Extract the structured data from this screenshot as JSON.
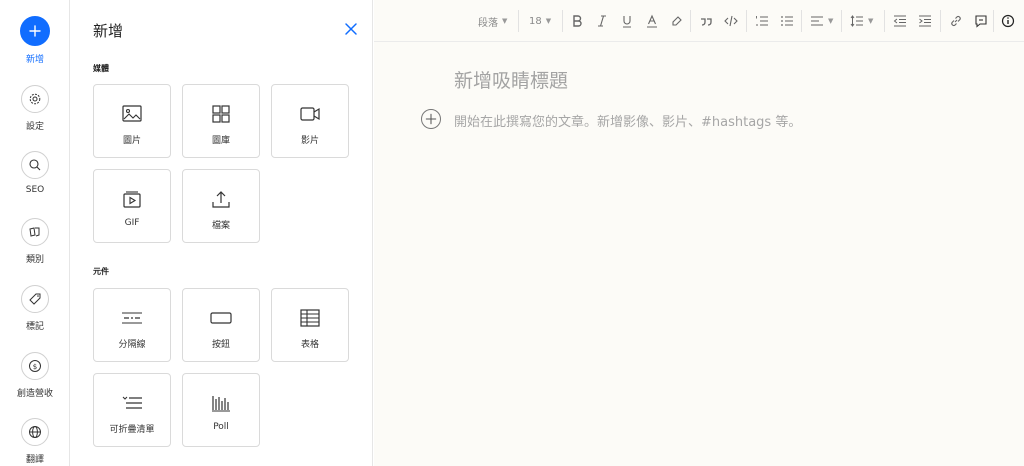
{
  "rail": {
    "items": [
      {
        "label": "新增",
        "icon": "plus-icon"
      },
      {
        "label": "設定",
        "icon": "gear-icon"
      },
      {
        "label": "SEO",
        "icon": "search-icon"
      },
      {
        "label": "類別",
        "icon": "category-icon"
      },
      {
        "label": "標記",
        "icon": "tag-icon"
      },
      {
        "label": "創造營收",
        "icon": "dollar-icon"
      },
      {
        "label": "翻譯",
        "icon": "globe-icon"
      }
    ],
    "accent": "#116dff"
  },
  "panel": {
    "title": "新增",
    "media_label": "媒體",
    "elements_label": "元件",
    "media": [
      {
        "label": "圖片",
        "icon": "image-icon"
      },
      {
        "label": "圖庫",
        "icon": "gallery-icon"
      },
      {
        "label": "影片",
        "icon": "video-icon"
      },
      {
        "label": "GIF",
        "icon": "gif-icon"
      },
      {
        "label": "檔案",
        "icon": "upload-icon"
      }
    ],
    "elements": [
      {
        "label": "分隔線",
        "icon": "divider-icon"
      },
      {
        "label": "按鈕",
        "icon": "button-icon"
      },
      {
        "label": "表格",
        "icon": "table-icon"
      },
      {
        "label": "可折疊清單",
        "icon": "collapsible-list-icon"
      },
      {
        "label": "Poll",
        "icon": "poll-icon"
      }
    ]
  },
  "toolbar": {
    "paragraph": "段落",
    "font_size": "18"
  },
  "editor": {
    "title_placeholder": "新增吸睛標題",
    "body_placeholder": "開始在此撰寫您的文章。新增影像、影片、#hashtags 等。"
  }
}
